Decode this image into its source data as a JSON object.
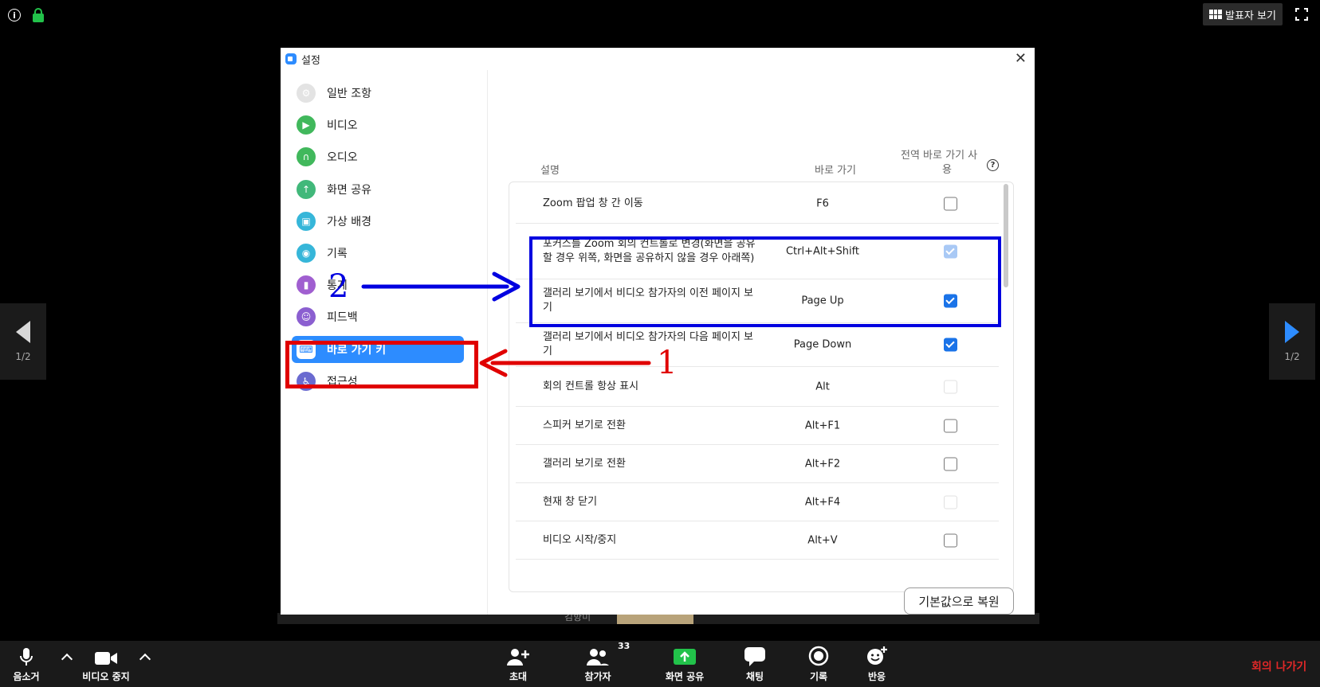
{
  "top_bar": {
    "speaker_view_label": "발표자 보기"
  },
  "gallery_nav": {
    "left_page": "1/2",
    "right_page": "1/2"
  },
  "tile_strip": {
    "partial_name": "김향미"
  },
  "dialog": {
    "title": "설정",
    "close_glyph": "✕"
  },
  "sidebar": {
    "items": [
      {
        "label": "일반 조항",
        "icon": "gear-icon",
        "color": "#e3e3e3"
      },
      {
        "label": "비디오",
        "icon": "video-icon",
        "color": "#41b85c"
      },
      {
        "label": "오디오",
        "icon": "headphone-icon",
        "color": "#41b85c"
      },
      {
        "label": "화면 공유",
        "icon": "share-screen-icon",
        "color": "#41b87a"
      },
      {
        "label": "가상 배경",
        "icon": "virtual-background-icon",
        "color": "#36b6d9"
      },
      {
        "label": "기록",
        "icon": "record-icon",
        "color": "#36b6d9"
      },
      {
        "label": "통계",
        "icon": "statistics-icon",
        "color": "#a05fd0"
      },
      {
        "label": "피드백",
        "icon": "feedback-icon",
        "color": "#8b5fd0"
      },
      {
        "label": "바로 가기 키",
        "icon": "keyboard-icon",
        "color": "#2d8cff",
        "active": true
      },
      {
        "label": "접근성",
        "icon": "accessibility-icon",
        "color": "#6a6ad0"
      }
    ]
  },
  "shortcuts": {
    "col_description": "설명",
    "col_shortcut": "바로 가기",
    "col_global_line1": "전역 바로 가기 사",
    "col_global_line2": "용",
    "help_glyph": "?",
    "rows": [
      {
        "desc": "Zoom 팝업 창 간 이동",
        "key": "F6",
        "state": "off"
      },
      {
        "desc": "포커스를 Zoom 회의 컨트롤로 변경(화면을 공유할 경우 위쪽, 화면을 공유하지 않을 경우 아래쪽)",
        "key": "Ctrl+Alt+Shift",
        "state": "on-light"
      },
      {
        "desc": "갤러리 보기에서 비디오 참가자의 이전 페이지 보기",
        "key": "Page Up",
        "state": "on"
      },
      {
        "desc": "갤러리 보기에서 비디오 참가자의 다음 페이지 보기",
        "key": "Page Down",
        "state": "on"
      },
      {
        "desc": "회의 컨트롤 항상 표시",
        "key": "Alt",
        "state": "dis"
      },
      {
        "desc": "스피커 보기로 전환",
        "key": "Alt+F1",
        "state": "off"
      },
      {
        "desc": "갤러리 보기로 전환",
        "key": "Alt+F2",
        "state": "off"
      },
      {
        "desc": "현재 창 닫기",
        "key": "Alt+F4",
        "state": "dis"
      },
      {
        "desc": "비디오 시작/중지",
        "key": "Alt+V",
        "state": "off"
      }
    ],
    "reset_label": "기본값으로 복원"
  },
  "annotations": {
    "label_one": "1",
    "label_two": "2",
    "blue_color": "#0000e0",
    "red_color": "#e00000"
  },
  "toolbar": {
    "mute_label": "음소거",
    "stop_video_label": "비디오 중지",
    "invite_label": "초대",
    "participants_label": "참가자",
    "participants_count": "33",
    "share_label": "화면 공유",
    "chat_label": "채팅",
    "record_label": "기록",
    "reactions_label": "반응",
    "leave_label": "회의 나가기"
  }
}
